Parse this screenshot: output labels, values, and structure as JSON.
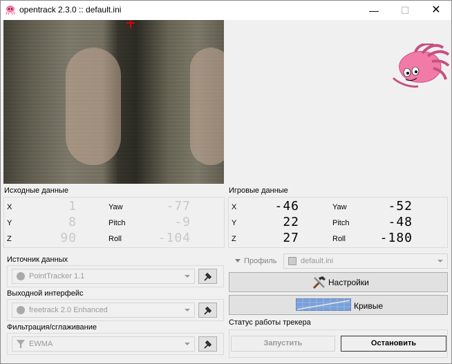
{
  "window": {
    "title": "opentrack 2.3.0 :: default.ini",
    "minimize": "—",
    "maximize": "☐",
    "close": "✕"
  },
  "raw": {
    "label": "Исходные данные",
    "x_label": "X",
    "x_val": "1",
    "y_label": "Y",
    "y_val": "8",
    "z_label": "Z",
    "z_val": "90",
    "yaw_label": "Yaw",
    "yaw_val": "-77",
    "pitch_label": "Pitch",
    "pitch_val": "-9",
    "roll_label": "Roll",
    "roll_val": "-104"
  },
  "game": {
    "label": "Игровые данные",
    "x_label": "X",
    "x_val": "-46",
    "y_label": "Y",
    "y_val": "22",
    "z_label": "Z",
    "z_val": "27",
    "yaw_label": "Yaw",
    "yaw_val": "-52",
    "pitch_label": "Pitch",
    "pitch_val": "-48",
    "roll_label": "Roll",
    "roll_val": "-180"
  },
  "tracker": {
    "label": "Источник данных",
    "value": "PointTracker 1.1"
  },
  "protocol": {
    "label": "Выходной интерфейс",
    "value": "freetrack 2.0 Enhanced"
  },
  "filter": {
    "label": "Фильтрация/сглаживание",
    "value": "EWMA"
  },
  "profile": {
    "label": "Профиль",
    "value": "default.ini"
  },
  "buttons": {
    "settings": "Настройки",
    "curves": "Кривые",
    "start": "Запустить",
    "stop": "Остановить"
  },
  "status": {
    "label": "Статус работы трекера"
  },
  "colors": {
    "octopus": "#f27aa6",
    "crosshair": "#e00000"
  }
}
